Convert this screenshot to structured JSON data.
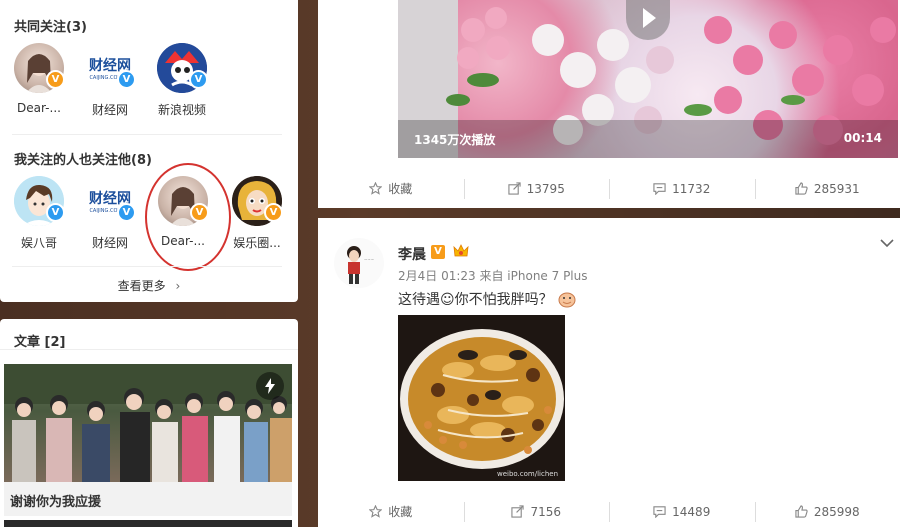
{
  "sidebar": {
    "mutual_title": "共同关注(3)",
    "mutual_users": [
      {
        "name": "Dear-...",
        "badge": "V",
        "badge_color": "#f79c1a"
      },
      {
        "name": "财经网",
        "badge": "V",
        "badge_color": "#2d9bf0"
      },
      {
        "name": "新浪视频",
        "badge": "V",
        "badge_color": "#2d9bf0"
      }
    ],
    "also_follow_title": "我关注的人也关注他(8)",
    "also_follow_users": [
      {
        "name": "娱八哥",
        "badge": "V",
        "badge_color": "#2d9bf0"
      },
      {
        "name": "财经网",
        "badge": "V",
        "badge_color": "#2d9bf0"
      },
      {
        "name": "Dear-...",
        "badge": "V",
        "badge_color": "#f79c1a"
      },
      {
        "name": "娱乐圈...",
        "badge": "V",
        "badge_color": "#f79c1a"
      }
    ],
    "more_label": "查看更多",
    "more_arrow": "›",
    "article_title": "文章 [2]",
    "article_caption": "谢谢你为我应援"
  },
  "feed": {
    "video": {
      "plays": "1345万次播放",
      "duration": "00:14"
    },
    "post1_actions": {
      "favorite": "收藏",
      "repost": "13795",
      "comment": "11732",
      "like": "285931"
    },
    "post2": {
      "author": "李晨",
      "verified_badge": "V",
      "meta": "2月4日 01:23 来自 iPhone 7 Plus",
      "text": "这待遇☺你不怕我胖吗？",
      "image_watermark": "weibo.com/lichen",
      "actions": {
        "favorite": "收藏",
        "repost": "7156",
        "comment": "14489",
        "like": "285998"
      }
    }
  },
  "colors": {
    "accent_orange": "#f79c1a",
    "verified_blue": "#2d9bf0",
    "highlight_red": "#d4332f"
  }
}
